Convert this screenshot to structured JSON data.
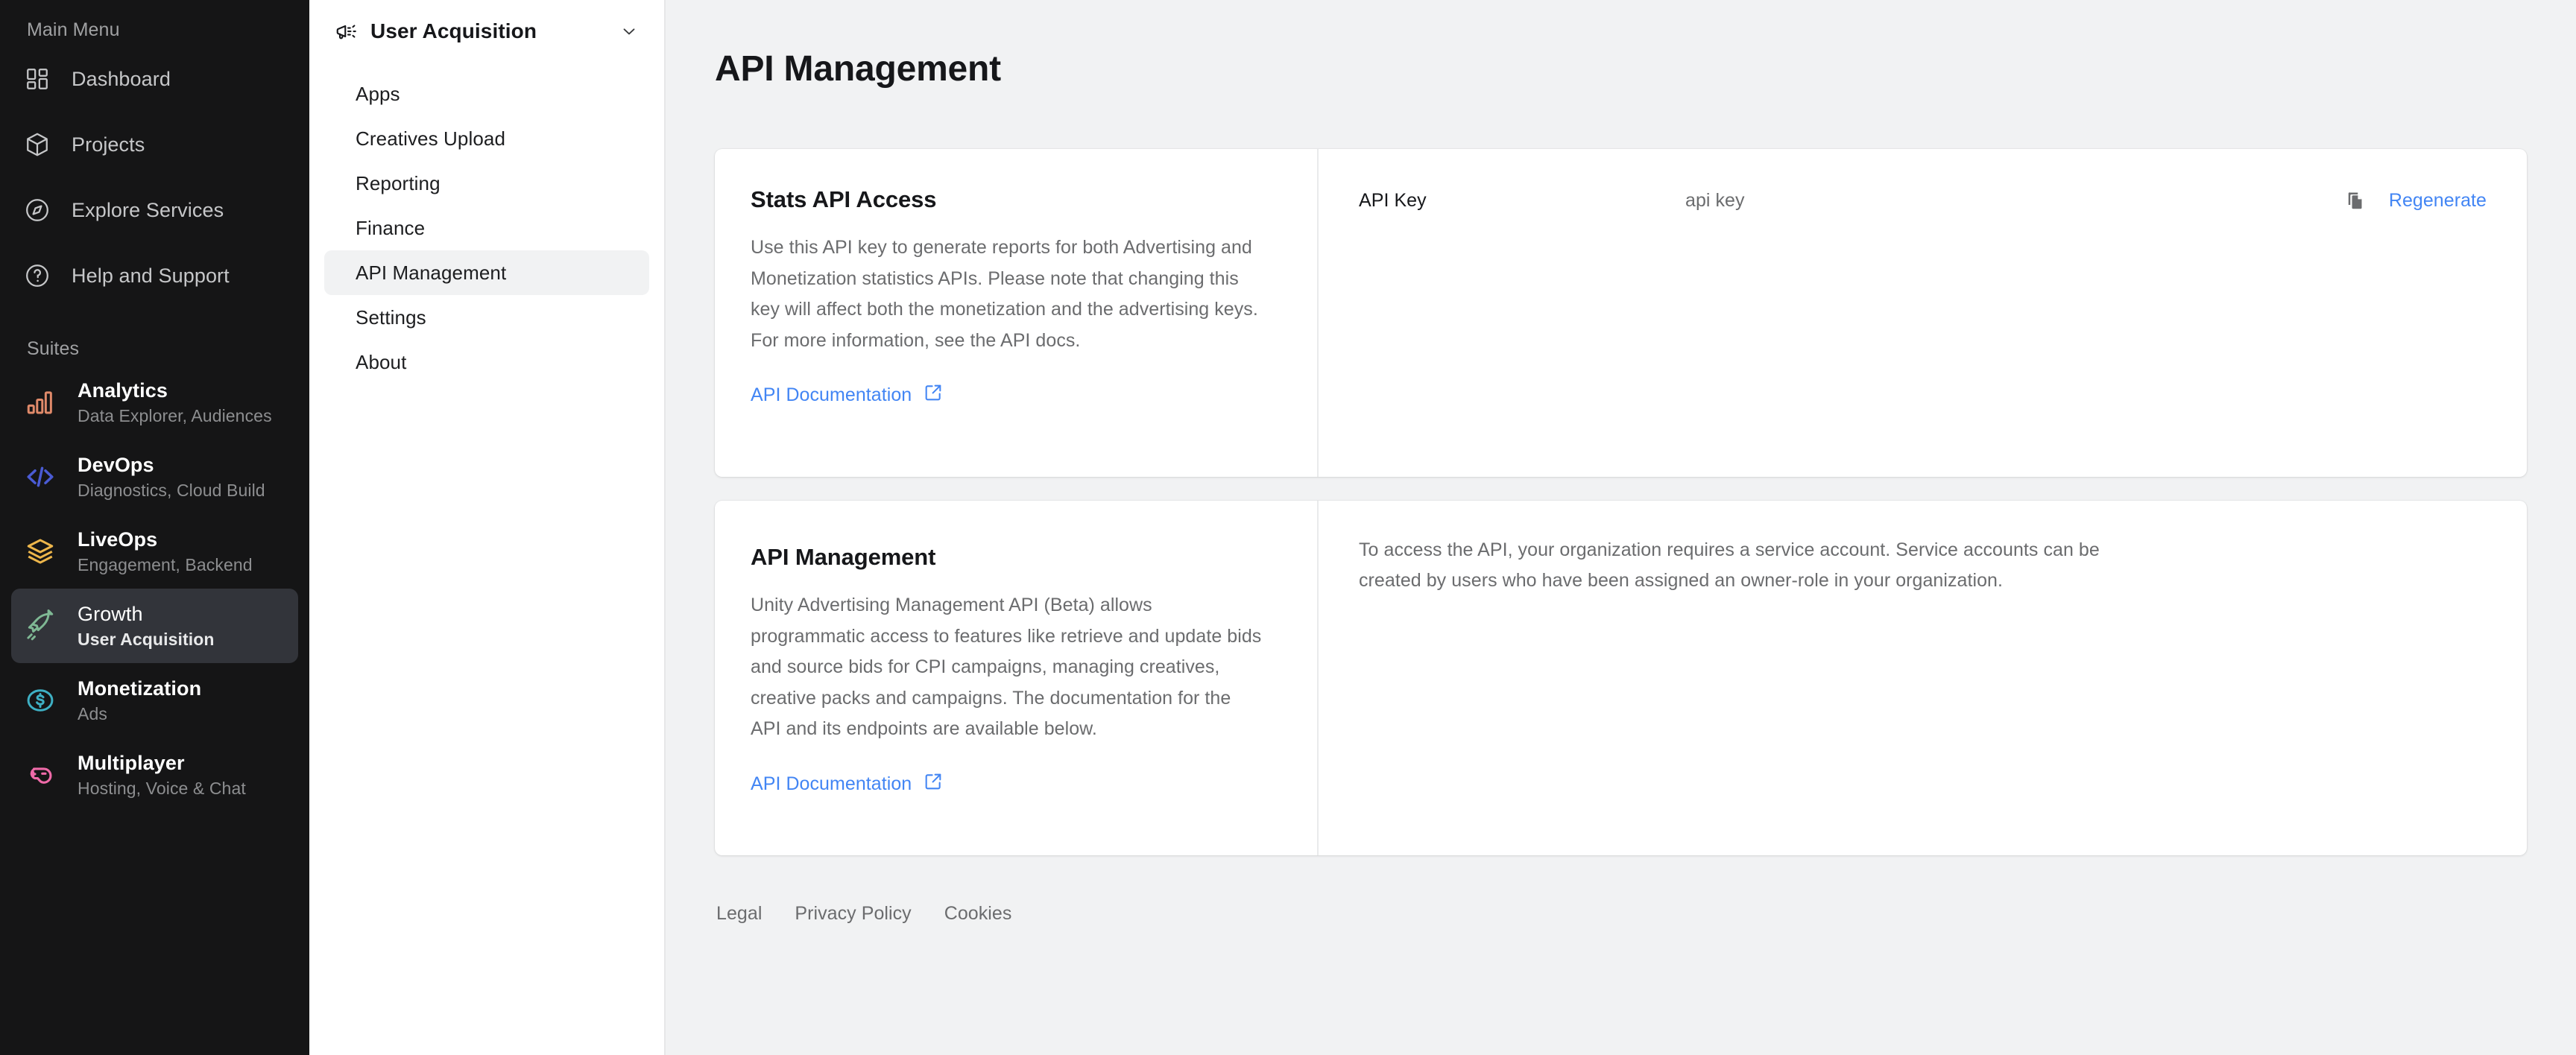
{
  "sidebar": {
    "main_label": "Main Menu",
    "suites_label": "Suites",
    "main_items": [
      {
        "label": "Dashboard",
        "icon": "dashboard-grid-icon"
      },
      {
        "label": "Projects",
        "icon": "cube-icon"
      },
      {
        "label": "Explore Services",
        "icon": "compass-icon"
      },
      {
        "label": "Help and Support",
        "icon": "question-circle-icon"
      }
    ],
    "suites": [
      {
        "title": "Analytics",
        "subtitle": "Data Explorer, Audiences",
        "icon": "bar-chart-icon",
        "color": "#e08a6a",
        "active": false
      },
      {
        "title": "DevOps",
        "subtitle": "Diagnostics, Cloud Build",
        "icon": "code-brackets-icon",
        "color": "#4a5bd4",
        "active": false
      },
      {
        "title": "LiveOps",
        "subtitle": "Engagement, Backend",
        "icon": "layers-icon",
        "color": "#edb64b",
        "active": false
      },
      {
        "title": "Growth",
        "subtitle": "User Acquisition",
        "icon": "rocket-icon",
        "color": "#7fb894",
        "active": true
      },
      {
        "title": "Monetization",
        "subtitle": "Ads",
        "icon": "dollar-circle-icon",
        "color": "#3eb0c4",
        "active": false
      },
      {
        "title": "Multiplayer",
        "subtitle": "Hosting, Voice & Chat",
        "icon": "gamepad-icon",
        "color": "#ef6aa8",
        "active": false
      }
    ]
  },
  "subnav": {
    "title": "User Acquisition",
    "header_icon": "megaphone-icon",
    "chevron_icon": "chevron-down-icon",
    "items": [
      {
        "label": "Apps",
        "active": false
      },
      {
        "label": "Creatives Upload",
        "active": false
      },
      {
        "label": "Reporting",
        "active": false
      },
      {
        "label": "Finance",
        "active": false
      },
      {
        "label": "API Management",
        "active": true
      },
      {
        "label": "Settings",
        "active": false
      },
      {
        "label": "About",
        "active": false
      }
    ]
  },
  "main": {
    "page_title": "API Management",
    "stats_card": {
      "heading": "Stats API Access",
      "body": "Use this API key to generate reports for both Advertising and Monetization statistics APIs. Please note that changing this key will affect both the monetization and the advertising keys. For more information, see the API docs.",
      "doc_link": "API Documentation",
      "doc_link_icon": "external-link-icon",
      "key_label": "API Key",
      "key_value": "api key",
      "copy_icon": "copy-icon",
      "regenerate_label": "Regenerate"
    },
    "management_card": {
      "heading": "API Management",
      "body": "Unity Advertising Management API (Beta) allows programmatic access to features like retrieve and update bids and source bids for CPI campaigns, managing creatives, creative packs and campaigns. The documentation for the API and its endpoints are available below.",
      "doc_link": "API Documentation",
      "doc_link_icon": "external-link-icon",
      "right_body": "To access the API, your organization requires a service account. Service accounts can be created by users who have been assigned an owner-role in your organization."
    }
  },
  "footer": {
    "links": [
      {
        "label": "Legal"
      },
      {
        "label": "Privacy Policy"
      },
      {
        "label": "Cookies"
      }
    ]
  },
  "colors": {
    "accent_link": "#4285f4",
    "page_bg": "#f1f2f3",
    "sidebar_bg": "#151516",
    "sidebar_active": "#32343a"
  }
}
